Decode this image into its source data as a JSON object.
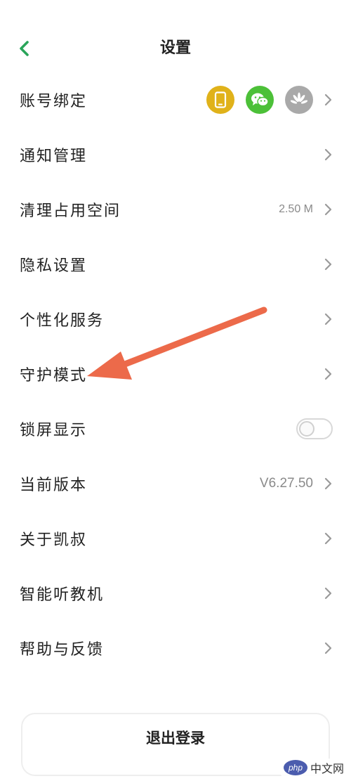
{
  "header": {
    "title": "设置",
    "back_icon": "chevron-left-icon"
  },
  "colors": {
    "accent": "#2aa55a",
    "phone_icon_bg": "#e0b21a",
    "wechat_icon_bg": "#4cc038",
    "huawei_icon_bg": "#a9a9a9",
    "arrow": "#ec6a4a"
  },
  "settings": {
    "account_binding": {
      "label": "账号绑定",
      "icons": [
        "phone-icon",
        "wechat-icon",
        "huawei-icon"
      ]
    },
    "notifications": {
      "label": "通知管理"
    },
    "clear_storage": {
      "label": "清理占用空间",
      "value": "2.50 M"
    },
    "privacy": {
      "label": "隐私设置"
    },
    "personalization": {
      "label": "个性化服务"
    },
    "guardian_mode": {
      "label": "守护模式"
    },
    "lockscreen": {
      "label": "锁屏显示",
      "toggle_on": false
    },
    "version": {
      "label": "当前版本",
      "value": "V6.27.50"
    },
    "about": {
      "label": "关于凯叔"
    },
    "smart_player": {
      "label": "智能听教机"
    },
    "help": {
      "label": "帮助与反馈"
    }
  },
  "logout": {
    "label": "退出登录"
  },
  "watermark": {
    "logo": "php",
    "text": "中文网"
  }
}
